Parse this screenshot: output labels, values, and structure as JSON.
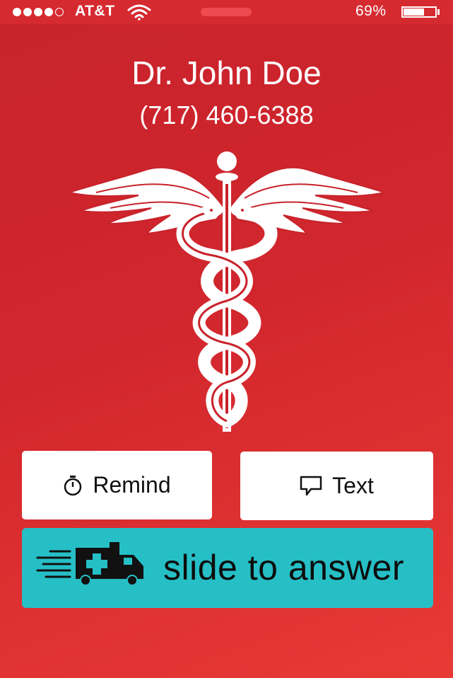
{
  "status_bar": {
    "signal_bars_filled": 4,
    "signal_bars_total": 5,
    "carrier": "AT&T",
    "battery_text": "69%",
    "battery_level": 0.69
  },
  "caller": {
    "name": "Dr. John Doe",
    "phone": "(717) 460-6388"
  },
  "actions": {
    "remind_label": "Remind",
    "text_label": "Text"
  },
  "slider": {
    "label": "slide to answer"
  },
  "colors": {
    "background_top": "#c8232c",
    "background_bottom": "#e83a35",
    "slider_accent": "#26bfc6",
    "button_bg": "#ffffff"
  },
  "icons": {
    "caduceus": "caduceus-icon",
    "remind": "stopwatch-icon",
    "text": "speech-bubble-icon",
    "slider": "ambulance-icon"
  }
}
